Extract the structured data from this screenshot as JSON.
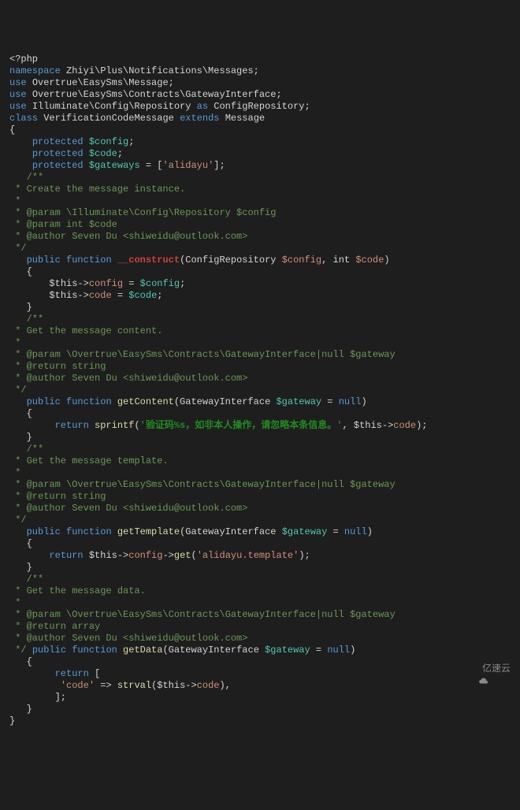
{
  "lang": "php",
  "code": {
    "open_tag": "<?php",
    "ns_kw": "namespace",
    "ns_path": "Zhiyi\\Plus\\Notifications\\Messages;",
    "use_kw": "use",
    "as_kw": "as",
    "use1": "Overtrue\\EasySms\\Message;",
    "use2": "Overtrue\\EasySms\\Contracts\\GatewayInterface;",
    "use3": "Illuminate\\Config\\Repository",
    "use3_alias": "ConfigRepository;",
    "class_kw": "class",
    "class_name": "VerificationCodeMessage",
    "extends_kw": "extends",
    "parent_name": "Message",
    "protected_kw": "protected",
    "var_config": "$config",
    "var_code": "$code",
    "var_gateways": "$gateways",
    "arr_open": " = [",
    "alidayu_str": "'alidayu'",
    "arr_close": "];",
    "cmt_open": "/**",
    "cmt_star": " *",
    "cmt_create": " * Create the message instance.",
    "cmt_param_config": " * @param \\Illuminate\\Config\\Repository $config",
    "cmt_param_code": " * @param int $code",
    "cmt_author": " * @author Seven Du <shiweidu@outlook.com>",
    "cmt_close": " */",
    "cmt_close2": " */ ",
    "public_kw": "public",
    "function_kw": "function",
    "ctor": "__construct",
    "ctor_sig_open": "(ConfigRepository ",
    "ctor_sig_mid": ", int ",
    "ctor_sig_close": ")",
    "brace_open": "{",
    "brace_close": "}",
    "this_arrow": "$this->",
    "eq": " = ",
    "semi": ";",
    "cmt_content": " * Get the message content.",
    "cmt_param_gw": " * @param \\Overtrue\\EasySms\\Contracts\\GatewayInterface|null $gateway",
    "cmt_ret_str": " * @return string",
    "fn_getContent": "getContent",
    "gw_sig_open": "(GatewayInterface ",
    "var_gateway": "$gateway",
    "eq_null": " = ",
    "null_kw": "null",
    "close_paren": ")",
    "return_kw": "return",
    "sprintf": "sprintf",
    "sprintf_open": "(",
    "cn_str": "'验证码%s，如非本人操作，请忽略本条信息。'",
    "sprintf_mid": ", $this->",
    "sprintf_close": ");",
    "cmt_template": " * Get the message template.",
    "fn_getTemplate": "getTemplate",
    "ret_this": " $this->",
    "get_method": "get",
    "arrow": "->",
    "tmpl_str": "'alidayu.template'",
    "tmpl_close": ");",
    "cmt_data": " * Get the message data.",
    "cmt_ret_arr": " * @return array",
    "fn_getData": "getData",
    "ret_arr_open": " [",
    "code_key": "'code'",
    "fat_arrow": " => ",
    "strval": "strval",
    "strval_open": "($this->",
    "strval_close": "),",
    "arr_close2": "];",
    "prop_config": "config",
    "prop_code": "code",
    "space": " "
  },
  "watermark": {
    "text": "亿速云"
  }
}
